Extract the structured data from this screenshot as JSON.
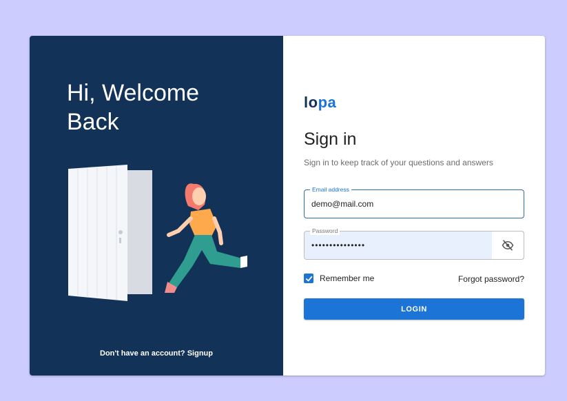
{
  "left_panel": {
    "welcome_line1": "Hi, Welcome",
    "welcome_line2": "Back",
    "signup_prompt": "Don't have an account?",
    "signup_link": "Signup"
  },
  "brand": {
    "logo_part1": "lo",
    "logo_part2": "pa",
    "dark": "#123357",
    "accent": "#1b74d6"
  },
  "form": {
    "title": "Sign in",
    "subtitle": "Sign in to keep track of your questions and answers",
    "email": {
      "label": "Email address",
      "value": "demo@mail.com"
    },
    "password": {
      "label": "Password",
      "value": "•••••••••••••••"
    },
    "remember_label": "Remember me",
    "remember_checked": true,
    "forgot_label": "Forgot password?",
    "login_label": "LOGIN"
  },
  "icons": {
    "password_toggle": "eye-off-icon",
    "checkbox": "checkmark-icon"
  }
}
